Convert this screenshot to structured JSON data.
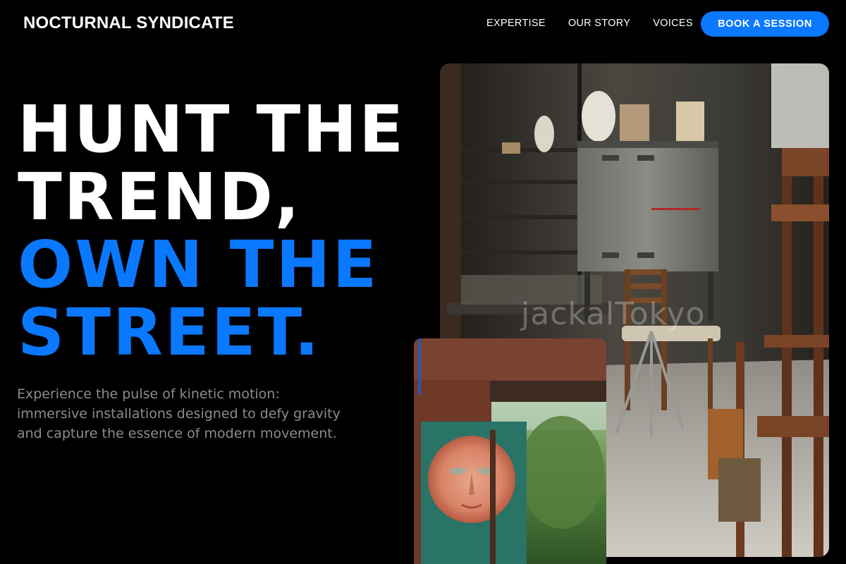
{
  "brand": {
    "name": "NOCTURNAL SYNDICATE"
  },
  "nav": {
    "items": [
      "EXPERTISE",
      "OUR STORY",
      "VOICES"
    ],
    "cta_label": "BOOK A SESSION"
  },
  "hero": {
    "headline_lines": [
      "HUNT THE",
      "TREND,",
      "OWN THE",
      "STREET."
    ],
    "description": "Experience the pulse of kinetic motion: immersive installations designed to defy gravity and capture the essence of modern movement."
  },
  "images": {
    "main_watermark": "jackalTokyo"
  },
  "colors": {
    "background": "#000000",
    "accent": "#0a78ff",
    "text": "#ffffff",
    "muted_text": "#8c8c8c"
  }
}
